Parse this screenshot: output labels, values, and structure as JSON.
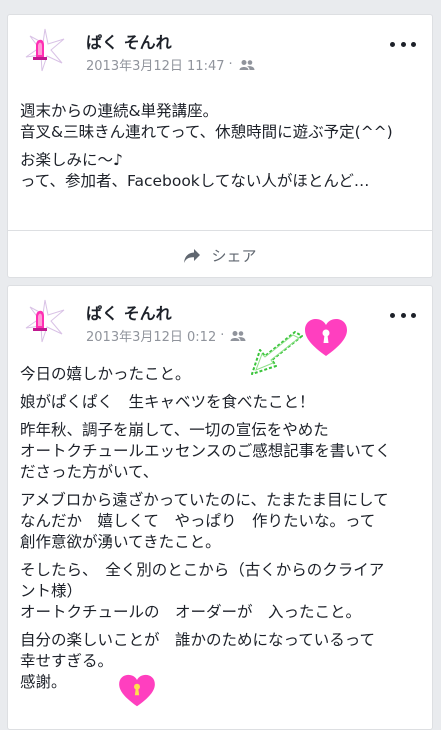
{
  "posts": [
    {
      "author": "ぱく そんれ",
      "timestamp": "2013年3月12日 11:47",
      "dot": "·",
      "paragraphs": [
        "週末からの連続&単発講座。\n音叉&三昧きん連れてって、休憩時間に遊ぶ予定(^^)",
        "お楽しみに〜♪\nって、参加者、Facebookしてない人がほとんど…"
      ],
      "share_label": "シェア"
    },
    {
      "author": "ぱく そんれ",
      "timestamp": "2013年3月12日 0:12",
      "dot": "·",
      "paragraphs": [
        "今日の嬉しかったこと。",
        "娘がぱくぱく　生キャベツを食べたこと！",
        "昨年秋、調子を崩して、一切の宣伝をやめた\nオートクチュールエッセンスのご感想記事を書いてく\nださった方がいて、",
        "アメブロから遠ざかっていたのに、たまたま目にして\nなんだか　嬉しくて　やっぱり　作りたいな。って\n創作意欲が湧いてきたこと。",
        "そしたら、　全く別のとこから（古くからのクライア\nント様）\nオートクチュールの　オーダーが　入ったこと。",
        "自分の楽しいことが　誰かのためになっているって\n幸せすぎる。\n感謝。"
      ]
    }
  ],
  "colors": {
    "background": "#e9ebee",
    "text": "#1d2129",
    "meta": "#90949c",
    "heart": "#ff3fbf",
    "arrow": "#39c43a"
  },
  "icons": {
    "avatar": "logo-star-icon",
    "audience": "friends-icon",
    "more": "more-dots-icon",
    "share": "share-arrow-icon",
    "heart": "heart-icon",
    "arrow": "arrow-icon"
  }
}
